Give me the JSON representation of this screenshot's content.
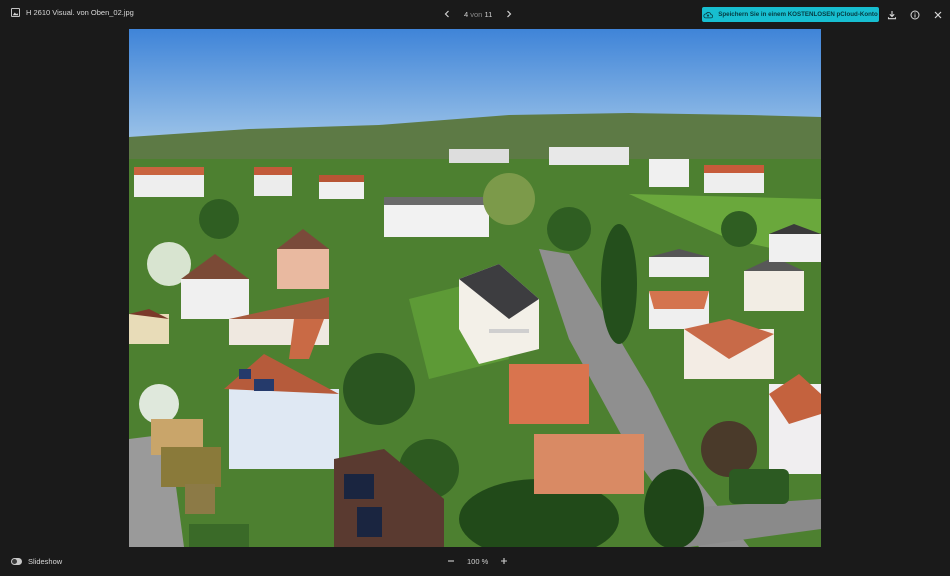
{
  "topbar": {
    "file_name": "H 2610 Visual. von Oben_02.jpg",
    "file_icon": "image-file-icon",
    "pager": {
      "current": "4",
      "separator": "von",
      "total": "11"
    },
    "cta_label": "Speichern Sie in einem KOSTENLOSEN pCloud-Konto",
    "cta_icon": "cloud-upload-icon",
    "actions": [
      "download-icon",
      "info-icon",
      "close-icon"
    ]
  },
  "bottombar": {
    "slideshow_label": "Slideshow",
    "zoom_value": "100",
    "zoom_unit": "%"
  },
  "colors": {
    "background": "#1a1a1a",
    "accent": "#17bed0",
    "sky": "#4a8ad6",
    "grass": "#4f8a2e",
    "roof_red": "#c9643f",
    "wall_white": "#eeeeee"
  }
}
